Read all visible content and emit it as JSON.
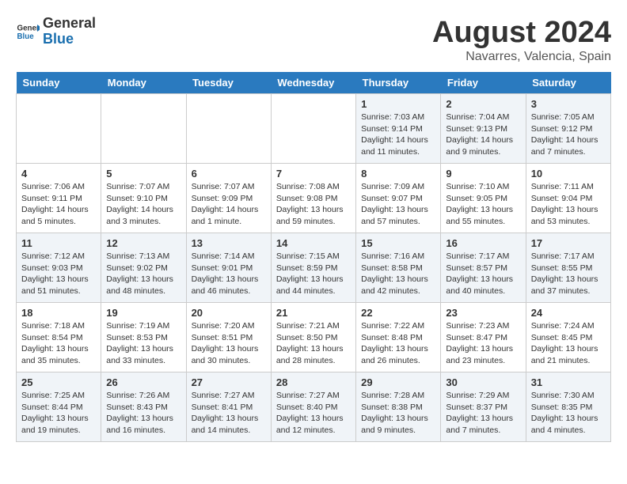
{
  "logo": {
    "general": "General",
    "blue": "Blue"
  },
  "title": "August 2024",
  "location": "Navarres, Valencia, Spain",
  "days_of_week": [
    "Sunday",
    "Monday",
    "Tuesday",
    "Wednesday",
    "Thursday",
    "Friday",
    "Saturday"
  ],
  "weeks": [
    [
      {
        "day": "",
        "info": ""
      },
      {
        "day": "",
        "info": ""
      },
      {
        "day": "",
        "info": ""
      },
      {
        "day": "",
        "info": ""
      },
      {
        "day": "1",
        "info": "Sunrise: 7:03 AM\nSunset: 9:14 PM\nDaylight: 14 hours\nand 11 minutes."
      },
      {
        "day": "2",
        "info": "Sunrise: 7:04 AM\nSunset: 9:13 PM\nDaylight: 14 hours\nand 9 minutes."
      },
      {
        "day": "3",
        "info": "Sunrise: 7:05 AM\nSunset: 9:12 PM\nDaylight: 14 hours\nand 7 minutes."
      }
    ],
    [
      {
        "day": "4",
        "info": "Sunrise: 7:06 AM\nSunset: 9:11 PM\nDaylight: 14 hours\nand 5 minutes."
      },
      {
        "day": "5",
        "info": "Sunrise: 7:07 AM\nSunset: 9:10 PM\nDaylight: 14 hours\nand 3 minutes."
      },
      {
        "day": "6",
        "info": "Sunrise: 7:07 AM\nSunset: 9:09 PM\nDaylight: 14 hours\nand 1 minute."
      },
      {
        "day": "7",
        "info": "Sunrise: 7:08 AM\nSunset: 9:08 PM\nDaylight: 13 hours\nand 59 minutes."
      },
      {
        "day": "8",
        "info": "Sunrise: 7:09 AM\nSunset: 9:07 PM\nDaylight: 13 hours\nand 57 minutes."
      },
      {
        "day": "9",
        "info": "Sunrise: 7:10 AM\nSunset: 9:05 PM\nDaylight: 13 hours\nand 55 minutes."
      },
      {
        "day": "10",
        "info": "Sunrise: 7:11 AM\nSunset: 9:04 PM\nDaylight: 13 hours\nand 53 minutes."
      }
    ],
    [
      {
        "day": "11",
        "info": "Sunrise: 7:12 AM\nSunset: 9:03 PM\nDaylight: 13 hours\nand 51 minutes."
      },
      {
        "day": "12",
        "info": "Sunrise: 7:13 AM\nSunset: 9:02 PM\nDaylight: 13 hours\nand 48 minutes."
      },
      {
        "day": "13",
        "info": "Sunrise: 7:14 AM\nSunset: 9:01 PM\nDaylight: 13 hours\nand 46 minutes."
      },
      {
        "day": "14",
        "info": "Sunrise: 7:15 AM\nSunset: 8:59 PM\nDaylight: 13 hours\nand 44 minutes."
      },
      {
        "day": "15",
        "info": "Sunrise: 7:16 AM\nSunset: 8:58 PM\nDaylight: 13 hours\nand 42 minutes."
      },
      {
        "day": "16",
        "info": "Sunrise: 7:17 AM\nSunset: 8:57 PM\nDaylight: 13 hours\nand 40 minutes."
      },
      {
        "day": "17",
        "info": "Sunrise: 7:17 AM\nSunset: 8:55 PM\nDaylight: 13 hours\nand 37 minutes."
      }
    ],
    [
      {
        "day": "18",
        "info": "Sunrise: 7:18 AM\nSunset: 8:54 PM\nDaylight: 13 hours\nand 35 minutes."
      },
      {
        "day": "19",
        "info": "Sunrise: 7:19 AM\nSunset: 8:53 PM\nDaylight: 13 hours\nand 33 minutes."
      },
      {
        "day": "20",
        "info": "Sunrise: 7:20 AM\nSunset: 8:51 PM\nDaylight: 13 hours\nand 30 minutes."
      },
      {
        "day": "21",
        "info": "Sunrise: 7:21 AM\nSunset: 8:50 PM\nDaylight: 13 hours\nand 28 minutes."
      },
      {
        "day": "22",
        "info": "Sunrise: 7:22 AM\nSunset: 8:48 PM\nDaylight: 13 hours\nand 26 minutes."
      },
      {
        "day": "23",
        "info": "Sunrise: 7:23 AM\nSunset: 8:47 PM\nDaylight: 13 hours\nand 23 minutes."
      },
      {
        "day": "24",
        "info": "Sunrise: 7:24 AM\nSunset: 8:45 PM\nDaylight: 13 hours\nand 21 minutes."
      }
    ],
    [
      {
        "day": "25",
        "info": "Sunrise: 7:25 AM\nSunset: 8:44 PM\nDaylight: 13 hours\nand 19 minutes."
      },
      {
        "day": "26",
        "info": "Sunrise: 7:26 AM\nSunset: 8:43 PM\nDaylight: 13 hours\nand 16 minutes."
      },
      {
        "day": "27",
        "info": "Sunrise: 7:27 AM\nSunset: 8:41 PM\nDaylight: 13 hours\nand 14 minutes."
      },
      {
        "day": "28",
        "info": "Sunrise: 7:27 AM\nSunset: 8:40 PM\nDaylight: 13 hours\nand 12 minutes."
      },
      {
        "day": "29",
        "info": "Sunrise: 7:28 AM\nSunset: 8:38 PM\nDaylight: 13 hours\nand 9 minutes."
      },
      {
        "day": "30",
        "info": "Sunrise: 7:29 AM\nSunset: 8:37 PM\nDaylight: 13 hours\nand 7 minutes."
      },
      {
        "day": "31",
        "info": "Sunrise: 7:30 AM\nSunset: 8:35 PM\nDaylight: 13 hours\nand 4 minutes."
      }
    ]
  ]
}
